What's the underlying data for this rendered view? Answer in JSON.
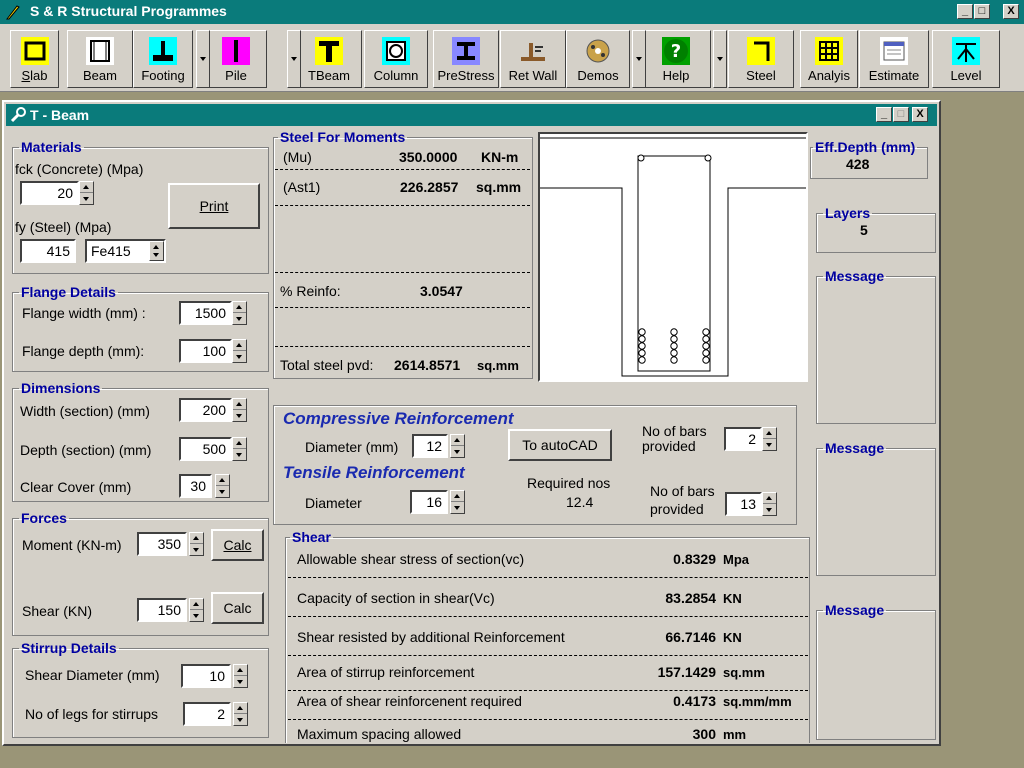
{
  "app": {
    "title": "S & R Structural Programmes"
  },
  "toolbar": [
    {
      "label": "Slab",
      "icon": "slab-icon",
      "color": "#ffff00"
    },
    {
      "label": "Beam",
      "icon": "beam-icon",
      "color": "#ffffff"
    },
    {
      "label": "Footing",
      "icon": "footing-icon",
      "color": "#00ffff"
    },
    {
      "label": "Pile",
      "icon": "pile-icon",
      "color": "#ff00ff"
    },
    {
      "label": "TBeam",
      "icon": "tbeam-icon",
      "color": "#ffff00"
    },
    {
      "label": "Column",
      "icon": "column-icon",
      "color": "#00ffff"
    },
    {
      "label": "PreStress",
      "icon": "prestress-icon",
      "color": "#8888ff"
    },
    {
      "label": "Ret Wall",
      "icon": "retwall-icon",
      "color": "#d4d0c8"
    },
    {
      "label": "Demos",
      "icon": "demos-icon",
      "color": "#d4d0c8"
    },
    {
      "label": "Help",
      "icon": "help-icon",
      "color": "#00a000"
    },
    {
      "label": "Steel",
      "icon": "steel-icon",
      "color": "#ffff00"
    },
    {
      "label": "Analyis",
      "icon": "analysis-icon",
      "color": "#ffff00"
    },
    {
      "label": "Estimate",
      "icon": "estimate-icon",
      "color": "#ffffff"
    },
    {
      "label": "Level",
      "icon": "level-icon",
      "color": "#00ffff"
    }
  ],
  "window": {
    "title": "T - Beam"
  },
  "materials": {
    "legend": "Materials",
    "fck_label": "fck (Concrete) (Mpa)",
    "fck": "20",
    "fy_label": "fy (Steel) (Mpa)",
    "fy": "415",
    "grade": "Fe415",
    "print": "Print"
  },
  "flange": {
    "legend": "Flange Details",
    "width_label": "Flange width (mm) :",
    "width": "1500",
    "depth_label": "Flange depth (mm):",
    "depth": "100"
  },
  "dimensions": {
    "legend": "Dimensions",
    "width_label": "Width (section) (mm)",
    "width": "200",
    "depth_label": "Depth (section) (mm)",
    "depth": "500",
    "cover_label": "Clear Cover (mm)",
    "cover": "30"
  },
  "forces": {
    "legend": "Forces",
    "moment_label": "Moment (KN-m)",
    "moment": "350",
    "calc1": "Calc",
    "shear_label": "Shear (KN)",
    "shear": "150",
    "calc2": "Calc"
  },
  "stirrup": {
    "legend": "Stirrup Details",
    "dia_label": "Shear Diameter (mm)",
    "dia": "10",
    "legs_label": "No of legs for stirrups",
    "legs": "2"
  },
  "moments": {
    "legend": "Steel For Moments",
    "mu_label": "(Mu)",
    "mu": "350.0000",
    "mu_unit": "KN-m",
    "ast_label": "(Ast1)",
    "ast": "226.2857",
    "ast_unit": "sq.mm",
    "reinfo_label": "% Reinfo:",
    "reinfo": "3.0547",
    "total_label": "Total steel pvd:",
    "total": "2614.8571",
    "total_unit": "sq.mm"
  },
  "reinf": {
    "comp_title": "Compressive Reinforcement",
    "comp_dia_label": "Diameter (mm)",
    "comp_dia": "12",
    "autocad": "To autoCAD",
    "comp_bars_label1": "No of bars",
    "comp_bars_label2": "provided",
    "comp_bars": "2",
    "tens_title": "Tensile Reinforcement",
    "tens_dia_label": "Diameter",
    "tens_dia": "16",
    "req_label": "Required nos",
    "req": "12.4",
    "tens_bars_label1": "No of bars",
    "tens_bars_label2": "provided",
    "tens_bars": "13"
  },
  "shear": {
    "legend": "Shear",
    "rows": [
      {
        "label": "Allowable shear stress of section(vc)",
        "value": "0.8329",
        "unit": "Mpa"
      },
      {
        "label": "Capacity of section in shear(Vc)",
        "value": "83.2854",
        "unit": "KN"
      },
      {
        "label": "Shear resisted by additional Reinforcement",
        "value": "66.7146",
        "unit": "KN"
      },
      {
        "label": "Area of stirrup  reinforcement",
        "value": "157.1429",
        "unit": "sq.mm"
      },
      {
        "label": "Area of shear reinforcenent required",
        "value": "0.4173",
        "unit": "sq.mm/mm"
      },
      {
        "label": "Maximum spacing allowed",
        "value": "300",
        "unit": "mm"
      }
    ]
  },
  "right": {
    "eff_legend": "Eff.Depth (mm)",
    "eff": "428",
    "layers_legend": "Layers",
    "layers": "5",
    "msg1": "Message",
    "msg2": "Message",
    "msg3": "Message"
  }
}
